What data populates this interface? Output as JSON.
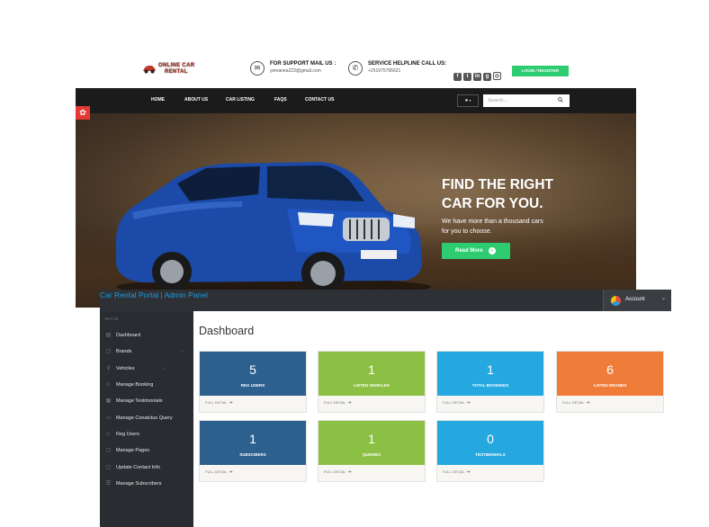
{
  "site": {
    "logo_text_1": "ONLINE CAR",
    "logo_text_2": "RENTAL",
    "support": {
      "title": "FOR SUPPORT MAIL US :",
      "value": "yemanea223@gmail.com",
      "icon": "mail-icon"
    },
    "helpline": {
      "title": "SERVICE HELPLINE CALL US:",
      "value": "+251975795621",
      "icon": "phone-icon"
    },
    "social": [
      "facebook-icon",
      "twitter-icon",
      "linkedin-icon",
      "google-plus-icon",
      "instagram-icon"
    ],
    "login_label": "LOGIN / REGISTER",
    "nav": [
      "HOME",
      "ABOUT US",
      "CAR LISTING",
      "FAQS",
      "CONTACT US"
    ],
    "search_placeholder": "Search...",
    "hero": {
      "title_line1": "FIND THE RIGHT",
      "title_line2": "CAR FOR YOU.",
      "subtitle_line1": "We have more than a thousand cars",
      "subtitle_line2": "for you to choose.",
      "cta": "Read More",
      "cta_arrow": "›"
    },
    "colors": {
      "accent_green": "#2ecc71",
      "nav_bg": "#1b1b1b",
      "settings_red": "#e53935"
    }
  },
  "admin": {
    "title": "Car Rental Portal | Admin Panel",
    "account_label": "Account",
    "account_caret": "⌄",
    "sidebar": {
      "section": "MAIN",
      "items": [
        {
          "label": "Dashboard",
          "icon": "dashboard-icon",
          "glyph": "▤",
          "chevron": ""
        },
        {
          "label": "Brands",
          "icon": "files-icon",
          "glyph": "▢",
          "chevron": "›"
        },
        {
          "label": "Vehicles",
          "icon": "sitemap-icon",
          "glyph": "⚲",
          "chevron": "›"
        },
        {
          "label": "Manage Booking",
          "icon": "users-icon",
          "glyph": "☺",
          "chevron": ""
        },
        {
          "label": "Manage Testimonials",
          "icon": "table-icon",
          "glyph": "▦",
          "chevron": ""
        },
        {
          "label": "Manage Conatctus Query",
          "icon": "desktop-icon",
          "glyph": "▭",
          "chevron": ""
        },
        {
          "label": "Reg Users",
          "icon": "users-icon",
          "glyph": "☺",
          "chevron": ""
        },
        {
          "label": "Manage Pages",
          "icon": "files-icon",
          "glyph": "▢",
          "chevron": ""
        },
        {
          "label": "Update Contact Info",
          "icon": "files-icon",
          "glyph": "▢",
          "chevron": ""
        },
        {
          "label": "Manage Subscribers",
          "icon": "table-icon",
          "glyph": "☰",
          "chevron": ""
        }
      ]
    },
    "dashboard_title": "Dashboard",
    "cards": [
      {
        "value": "5",
        "label": "REG USERS",
        "footer": "FULL DETAIL",
        "color": "#2d5f8f"
      },
      {
        "value": "1",
        "label": "LISTED VEHICLES",
        "footer": "FULL DETAIL",
        "color": "#8cc044"
      },
      {
        "value": "1",
        "label": "TOTAL BOOKINGS",
        "footer": "FULL DETAIL",
        "color": "#25a8e0"
      },
      {
        "value": "6",
        "label": "LISTED BRANDS",
        "footer": "FULL DETAIL",
        "color": "#f07c3a"
      },
      {
        "value": "1",
        "label": "SUBSCIBERS",
        "footer": "FULL DETAIL",
        "color": "#2d5f8f"
      },
      {
        "value": "1",
        "label": "QUERIES",
        "footer": "FULL DETAIL",
        "color": "#8cc044"
      },
      {
        "value": "0",
        "label": "TESTIMONIALS",
        "footer": "FULL DETAIL",
        "color": "#25a8e0"
      }
    ],
    "card_arrow": "➔"
  }
}
